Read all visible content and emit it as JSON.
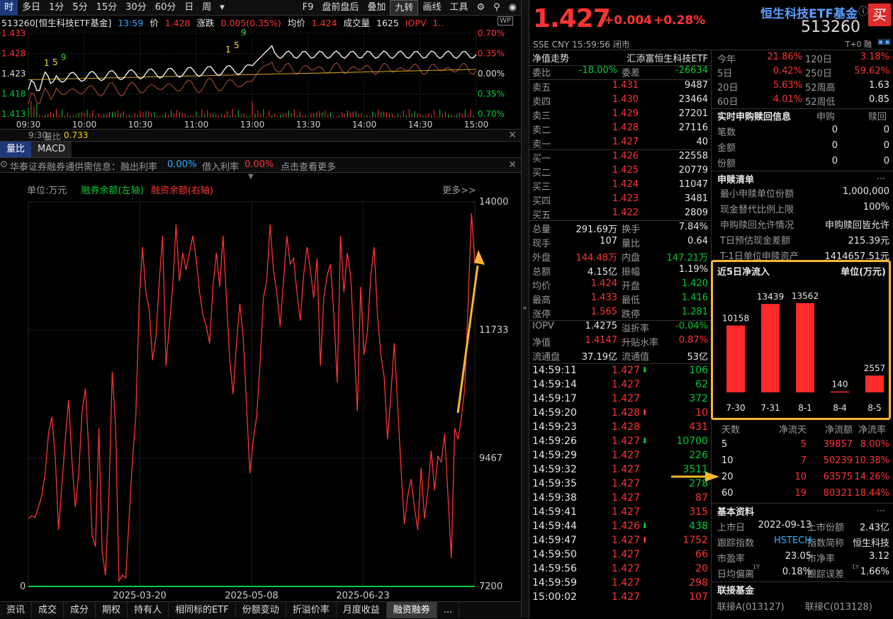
{
  "toolbar": {
    "left_items": [
      "时",
      "多日",
      "1分",
      "5分",
      "15分",
      "30分",
      "60分",
      "日",
      "周"
    ],
    "menu_arrow": "▾",
    "right_items": [
      "F9",
      "盘前盘后",
      "叠加",
      "九转",
      "画线",
      "工具"
    ]
  },
  "header_info": {
    "code_name": "513260[恒生科技ETF基金]",
    "time": "13:59",
    "price_label": "价",
    "price": "1.428",
    "change_label": "涨跌",
    "change": "0.005(0.35%)",
    "avg_label": "均价",
    "avg": "1.424",
    "vol_label": "成交量",
    "vol": "1625",
    "iopv_label": "IOPV",
    "iopv": "1.."
  },
  "intraday": {
    "price_ticks": [
      "1.433",
      "1.428",
      "1.423",
      "1.418",
      "1.413"
    ],
    "pct_ticks": [
      "0.70%",
      "0.35%",
      "0.00%",
      "0.35%",
      "0.70%"
    ],
    "time_ticks": [
      "09:30",
      "10:00",
      "10:30",
      "11:00",
      "13:00",
      "13:30",
      "14:00",
      "14:30",
      "15:00"
    ],
    "markers": [
      "1",
      "5",
      "9",
      "1",
      "5",
      "9"
    ],
    "ylim": [
      1.413,
      1.433
    ]
  },
  "volume_ratio": {
    "label": "量比",
    "value": "0.733",
    "prefix": "9:30"
  },
  "indicator_tabs": [
    "量比",
    "MACD"
  ],
  "margin_notice": {
    "text1": "华泰证券融券通供需信息：融出利率",
    "rate1": "0.00%",
    "text2": "借入利率",
    "rate2": "0.00%",
    "text3": "点击查看更多"
  },
  "margin_chart_header": {
    "unit": "单位:万元",
    "legend_left": "融券余额(左轴)",
    "legend_right": "融资余额(右轴)",
    "more": "更多>>"
  },
  "chart_data": {
    "type": "line",
    "x_ticks": [
      "2025-03-20",
      "2025-05-08",
      "2025-06-23"
    ],
    "y_left_ticks": [
      "0"
    ],
    "y_right_ticks": [
      "14000",
      "11733",
      "9467",
      "7200"
    ],
    "ylim_right": [
      7200,
      14000
    ],
    "series": [
      {
        "name": "融资余额(右轴)",
        "color": "#ff3333",
        "values": [
          8400,
          8450,
          8420,
          8600,
          8800,
          9200,
          9900,
          10200,
          9500,
          8200,
          9000,
          9800,
          10500,
          9400,
          8600,
          9200,
          10300,
          10700,
          9600,
          8100,
          7900,
          10000,
          7800,
          7400,
          8800,
          11000,
          10000,
          7300,
          7400,
          7350,
          8400,
          9400,
          10200,
          12200,
          13200,
          12400,
          12100,
          11200,
          11600,
          12600,
          13400,
          11100,
          11800,
          12500,
          13600,
          12600,
          13100,
          12800,
          13100,
          13400,
          13000,
          12400,
          12000,
          11800,
          11500,
          12500,
          13100,
          12500,
          13400,
          12300,
          11200,
          10600,
          11500,
          12200,
          11600,
          10400,
          9200,
          9800,
          10200,
          11100,
          12300,
          12600,
          13600,
          12800,
          12400,
          11800,
          12600,
          13400,
          12900,
          13000,
          12400,
          11900,
          12700,
          13200,
          12800,
          12300,
          13000,
          11100,
          12300,
          12700,
          12900,
          12000,
          10800,
          13400,
          12400,
          13100,
          12700,
          11500,
          10300,
          12500,
          11300,
          11700,
          12700,
          13200,
          12000,
          11300,
          10900,
          9800,
          10600,
          11500,
          10400,
          9300,
          8300,
          8800,
          9100,
          8600,
          8200,
          9300,
          8400,
          8900,
          9600,
          8900,
          9500,
          9400,
          9900,
          8800,
          7700,
          10000,
          9800,
          10200,
          10700,
          12200,
          13800,
          12900
        ]
      },
      {
        "name": "融券余额(左轴)",
        "color": "#00cc33",
        "values": [
          0,
          0,
          0,
          0,
          0
        ]
      }
    ],
    "arrow_color": "#f5b731"
  },
  "bottom_tabs": [
    "资讯",
    "成交",
    "成分",
    "期权",
    "持有人",
    "相同标的ETF",
    "份额变动",
    "折溢价率",
    "月度收益",
    "融资融券",
    "..."
  ],
  "quote": {
    "price": "1.427",
    "change": "+0.004",
    "pct": "+0.28%",
    "name": "恒生科技ETF基金",
    "code": "513260",
    "buy": "买",
    "info_icon": "ⓘ",
    "sub": "SSE  CNY  15:59:56  闭市",
    "t0": "T+0",
    "t0_extra": "融"
  },
  "net_value": {
    "label": "净值走势",
    "issuer": "汇添富恒生科技ETF"
  },
  "order_ratio": {
    "l1": "委比",
    "v1": "-18.00%",
    "l2": "委差",
    "v2": "-26634"
  },
  "asks": [
    {
      "label": "卖五",
      "price": "1.431",
      "vol": "9487"
    },
    {
      "label": "卖四",
      "price": "1.430",
      "vol": "23464"
    },
    {
      "label": "卖三",
      "price": "1.429",
      "vol": "27201"
    },
    {
      "label": "卖二",
      "price": "1.428",
      "vol": "27116"
    },
    {
      "label": "卖一",
      "price": "1.427",
      "vol": "40"
    }
  ],
  "bids": [
    {
      "label": "买一",
      "price": "1.426",
      "vol": "22558"
    },
    {
      "label": "买二",
      "price": "1.425",
      "vol": "20779"
    },
    {
      "label": "买三",
      "price": "1.424",
      "vol": "11047"
    },
    {
      "label": "买四",
      "price": "1.423",
      "vol": "3481"
    },
    {
      "label": "买五",
      "price": "1.422",
      "vol": "2809"
    }
  ],
  "stats": [
    {
      "l1": "总量",
      "v1": "291.69万",
      "c1": "wht",
      "l2": "换手",
      "v2": "7.84%",
      "c2": "wht"
    },
    {
      "l1": "现手",
      "v1": "107",
      "c1": "wht",
      "l2": "量比",
      "v2": "0.64",
      "c2": "wht"
    },
    {
      "l1": "外盘",
      "v1": "144.48万",
      "c1": "red",
      "l2": "内盘",
      "v2": "147.21万",
      "c2": "grn"
    },
    {
      "l1": "总额",
      "v1": "4.15亿",
      "c1": "wht",
      "l2": "振幅",
      "v2": "1.19%",
      "c2": "wht"
    },
    {
      "l1": "均价",
      "v1": "1.424",
      "c1": "red",
      "l2": "开盘",
      "v2": "1.420",
      "c2": "grn"
    },
    {
      "l1": "最高",
      "v1": "1.433",
      "c1": "red",
      "l2": "最低",
      "v2": "1.416",
      "c2": "grn"
    },
    {
      "l1": "涨停",
      "v1": "1.565",
      "c1": "red",
      "l2": "跌停",
      "v2": "1.281",
      "c2": "grn"
    }
  ],
  "stats2": [
    {
      "l1": "IOPV",
      "v1": "1.4275",
      "c1": "wht",
      "l2": "溢折率",
      "v2": "-0.04%",
      "c2": "grn"
    },
    {
      "l1": "净值",
      "v1": "1.4147",
      "c1": "red",
      "l2": "升贴水率",
      "v2": "0.87%",
      "c2": "red"
    },
    {
      "l1": "流通盘",
      "v1": "37.19亿",
      "c1": "wht",
      "l2": "流通值",
      "v2": "53亿",
      "c2": "wht"
    }
  ],
  "ticks": [
    {
      "t": "14:59:11",
      "p": "1.427",
      "a": "down",
      "v": "106",
      "vc": "grn"
    },
    {
      "t": "14:59:14",
      "p": "1.427",
      "a": "",
      "v": "62",
      "vc": "grn"
    },
    {
      "t": "14:59:17",
      "p": "1.427",
      "a": "",
      "v": "372",
      "vc": "grn"
    },
    {
      "t": "14:59:20",
      "p": "1.428",
      "a": "up",
      "v": "10",
      "vc": "red"
    },
    {
      "t": "14:59:23",
      "p": "1.428",
      "a": "",
      "v": "431",
      "vc": "red"
    },
    {
      "t": "14:59:26",
      "p": "1.427",
      "a": "down",
      "v": "10700",
      "vc": "grn"
    },
    {
      "t": "14:59:29",
      "p": "1.427",
      "a": "",
      "v": "226",
      "vc": "grn"
    },
    {
      "t": "14:59:32",
      "p": "1.427",
      "a": "",
      "v": "3511",
      "vc": "grn"
    },
    {
      "t": "14:59:35",
      "p": "1.427",
      "a": "",
      "v": "278",
      "vc": "grn"
    },
    {
      "t": "14:59:38",
      "p": "1.427",
      "a": "",
      "v": "87",
      "vc": "red"
    },
    {
      "t": "14:59:41",
      "p": "1.427",
      "a": "",
      "v": "315",
      "vc": "red"
    },
    {
      "t": "14:59:44",
      "p": "1.426",
      "a": "down",
      "v": "438",
      "vc": "grn"
    },
    {
      "t": "14:59:47",
      "p": "1.427",
      "a": "up",
      "v": "1752",
      "vc": "red"
    },
    {
      "t": "14:59:50",
      "p": "1.427",
      "a": "",
      "v": "66",
      "vc": "red"
    },
    {
      "t": "14:59:56",
      "p": "1.427",
      "a": "",
      "v": "20",
      "vc": "red"
    },
    {
      "t": "14:59:59",
      "p": "1.427",
      "a": "",
      "v": "298",
      "vc": "red"
    },
    {
      "t": "15:00:02",
      "p": "1.427",
      "a": "",
      "v": "107",
      "vc": "red"
    }
  ],
  "perf": [
    {
      "l1": "今年",
      "v1": "21.86%",
      "l2": "120日",
      "v2": "3.18%"
    },
    {
      "l1": "5日",
      "v1": "0.42%",
      "l2": "250日",
      "v2": "59.62%"
    },
    {
      "l1": "20日",
      "v1": "5.63%",
      "l2": "52周高",
      "v2": "1.63"
    },
    {
      "l1": "60日",
      "v1": "4.01%",
      "l2": "52周低",
      "v2": "0.85"
    }
  ],
  "creation": {
    "title": "实时申购赎回信息",
    "h1": "申购",
    "h2": "赎回",
    "rows": [
      {
        "l": "笔数",
        "a": "0",
        "b": "0"
      },
      {
        "l": "金额",
        "a": "0",
        "b": "0"
      },
      {
        "l": "份额",
        "a": "0",
        "b": "0"
      }
    ]
  },
  "redemption_list": {
    "title": "申赎清单",
    "more": "...",
    "rows": [
      {
        "l": "最小申赎单位份额",
        "v": "1,000,000"
      },
      {
        "l": "现金替代比例上限",
        "v": "100%"
      },
      {
        "l": "申购赎回允许情况",
        "v": "申购赎回皆允许"
      },
      {
        "l": "T日预估现金差额",
        "v": "215.39元"
      },
      {
        "l": "T-1日单位申赎资产",
        "v": "1414657.51元"
      }
    ]
  },
  "net_flow": {
    "title": "近5日净流入",
    "unit": "单位(万元)",
    "categories": [
      "7-30",
      "7-31",
      "8-1",
      "8-4",
      "8-5"
    ],
    "values": [
      10158,
      13439,
      13562,
      140,
      2557
    ],
    "labels": [
      "10158",
      "13439",
      "13562",
      "140",
      "2557"
    ],
    "bar_color": "#ff2a2a"
  },
  "flow_table": {
    "headers": [
      "天数",
      "净流天",
      "净流额",
      "净流率"
    ],
    "rows": [
      {
        "d": "5",
        "n": "5",
        "a": "39857",
        "r": "8.00%"
      },
      {
        "d": "10",
        "n": "7",
        "a": "50239",
        "r": "10.38%"
      },
      {
        "d": "20",
        "n": "10",
        "a": "63575",
        "r": "14.26%"
      },
      {
        "d": "60",
        "n": "19",
        "a": "80321",
        "r": "18.44%"
      }
    ]
  },
  "basic": {
    "title": "基本资料",
    "more": "...",
    "rows": [
      {
        "l1": "上市日",
        "v1": "2022-09-13",
        "l2": "上市份额",
        "v2": "2.43亿"
      },
      {
        "l1": "跟踪指数",
        "v1": "HSTECH",
        "l2": "指数简称",
        "v2": "恒生科技"
      },
      {
        "l1": "市盈率",
        "v1": "23.05",
        "l2": "市净率",
        "v2": "3.12"
      },
      {
        "l1": "日均偏离",
        "v1": "0.18%",
        "l2": "跟踪误差",
        "v2": "1.66%"
      }
    ],
    "superscript": "1Y"
  },
  "linked": {
    "title": "联接基金",
    "a": "联接A(013127)",
    "c": "联接C(013128)"
  },
  "colors": {
    "up": "#ff3333",
    "down": "#00cc33",
    "accent": "#f5b731",
    "link": "#5a9fff"
  }
}
